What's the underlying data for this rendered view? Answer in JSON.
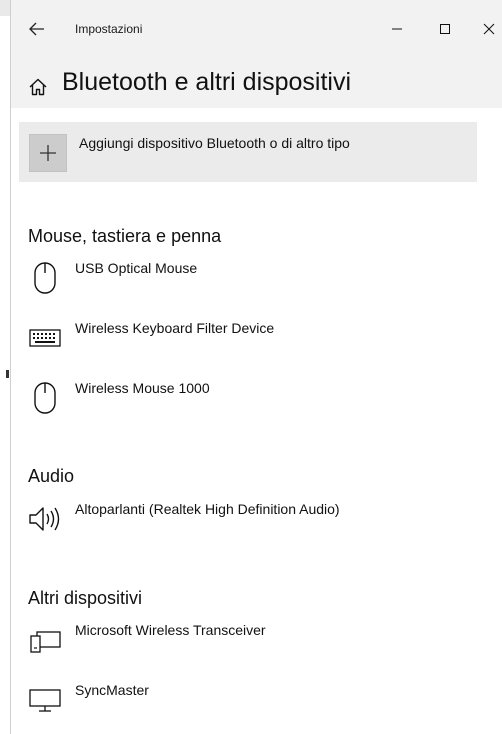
{
  "window": {
    "title": "Impostazioni",
    "buttons": {
      "minimize": "minimize-icon",
      "maximize": "maximize-icon",
      "close": "close-icon"
    }
  },
  "header": {
    "title": "Bluetooth e altri dispositivi",
    "icon": "home-icon"
  },
  "add_device": {
    "label": "Aggiungi dispositivo Bluetooth o di altro tipo",
    "icon": "plus-icon"
  },
  "sections": [
    {
      "title": "Mouse, tastiera e penna",
      "devices": [
        {
          "name": "USB Optical Mouse",
          "icon": "mouse-icon"
        },
        {
          "name": "Wireless Keyboard Filter Device",
          "icon": "keyboard-icon"
        },
        {
          "name": "Wireless Mouse 1000",
          "icon": "mouse-icon"
        }
      ]
    },
    {
      "title": "Audio",
      "devices": [
        {
          "name": "Altoparlanti (Realtek High Definition Audio)",
          "icon": "speaker-icon"
        }
      ]
    },
    {
      "title": "Altri dispositivi",
      "devices": [
        {
          "name": "Microsoft Wireless Transceiver",
          "icon": "devices-icon"
        },
        {
          "name": "SyncMaster",
          "icon": "monitor-icon"
        }
      ]
    }
  ]
}
